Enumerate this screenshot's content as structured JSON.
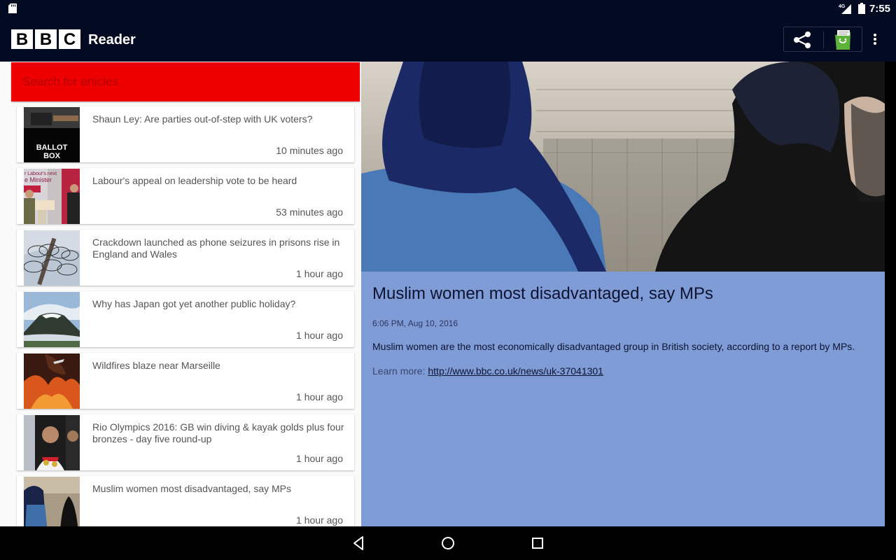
{
  "status_bar": {
    "time": "7:55",
    "network": "4G",
    "icons": [
      "sd-card-icon",
      "signal-icon",
      "battery-icon"
    ]
  },
  "app_bar": {
    "logo_letters": [
      "B",
      "B",
      "C"
    ],
    "title": "Reader",
    "actions": [
      "share-icon",
      "pocket-icon",
      "overflow-menu-icon"
    ]
  },
  "search": {
    "placeholder": "Search for articles",
    "value": ""
  },
  "articles": [
    {
      "title": "Shaun Ley: Are parties out-of-step with UK voters?",
      "time": "10 minutes ago",
      "thumb_text": "BALLOT BOX"
    },
    {
      "title": "Labour's appeal on leadership vote to be heard",
      "time": "53 minutes ago",
      "thumb_text": "r Labour's next e Minister"
    },
    {
      "title": "Crackdown launched as phone seizures in prisons rise in England and Wales",
      "time": "1 hour ago"
    },
    {
      "title": "Why has Japan got yet another public holiday?",
      "time": "1 hour ago"
    },
    {
      "title": "Wildfires blaze near Marseille",
      "time": "1 hour ago"
    },
    {
      "title": "Rio Olympics 2016: GB win diving & kayak golds plus four bronzes - day five round-up",
      "time": "1 hour ago"
    },
    {
      "title": "Muslim women most disadvantaged, say MPs",
      "time": "1 hour ago"
    }
  ],
  "detail": {
    "title": "Muslim women most disadvantaged, say MPs",
    "date": "6:06 PM, Aug 10, 2016",
    "summary": "Muslim women are the most economically disadvantaged group in British society, according to a report by MPs.",
    "learn_more_label": "Learn more:",
    "link": "http://www.bbc.co.uk/news/uk-37041301"
  },
  "colors": {
    "app_bar_bg": "#020b22",
    "search_bg": "#ee0000",
    "detail_bg": "#7f9cd7",
    "list_bg": "#fafafa"
  },
  "nav_bar": [
    "back-icon",
    "home-icon",
    "recents-icon"
  ]
}
